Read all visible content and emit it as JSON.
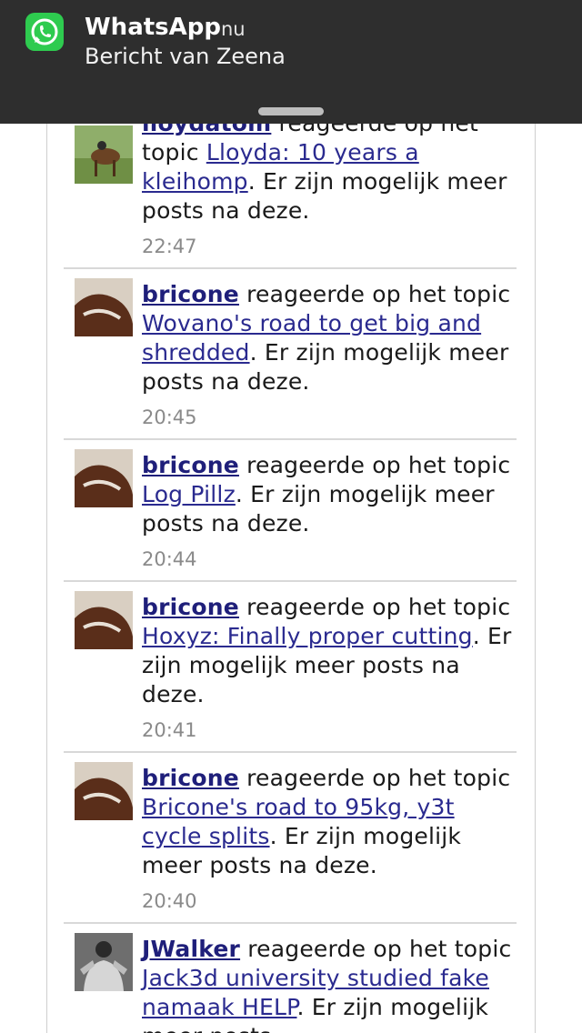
{
  "notification": {
    "app_name": "WhatsApp",
    "time": "nu",
    "body": "Bericht van Zeena",
    "icon": "whatsapp-icon"
  },
  "feed": {
    "items": [
      {
        "user": "lloydatom",
        "action": " reageerde op het topic ",
        "topic": "Lloyda: 10 years a kleihomp",
        "suffix": ". Er zijn mogelijk meer posts na deze.",
        "time": "22:47",
        "avatar": "horse-rider-avatar"
      },
      {
        "user": "bricone",
        "action": " reageerde op het topic ",
        "topic": "Wovano's road to get big and shredded",
        "suffix": ". Er zijn mogelijk meer posts na deze.",
        "time": "20:45",
        "avatar": "horse-avatar"
      },
      {
        "user": "bricone",
        "action": " reageerde op het topic ",
        "topic": "Log Pillz",
        "suffix": ". Er zijn mogelijk meer posts na deze.",
        "time": "20:44",
        "avatar": "horse-avatar"
      },
      {
        "user": "bricone",
        "action": " reageerde op het topic ",
        "topic": "Hoxyz: Finally proper cutting",
        "suffix": ". Er zijn mogelijk meer posts na deze.",
        "time": "20:41",
        "avatar": "horse-avatar"
      },
      {
        "user": "bricone",
        "action": " reageerde op het topic ",
        "topic": "Bricone's road to 95kg, y3t cycle splits",
        "suffix": ". Er zijn mogelijk meer posts na deze.",
        "time": "20:40",
        "avatar": "horse-avatar"
      },
      {
        "user": "JWalker",
        "action": " reageerde op het topic ",
        "topic": "Jack3d university studied fake namaak HELP",
        "suffix": ". Er zijn mogelijk meer posts",
        "time": "",
        "avatar": "bodybuilder-avatar"
      }
    ]
  }
}
